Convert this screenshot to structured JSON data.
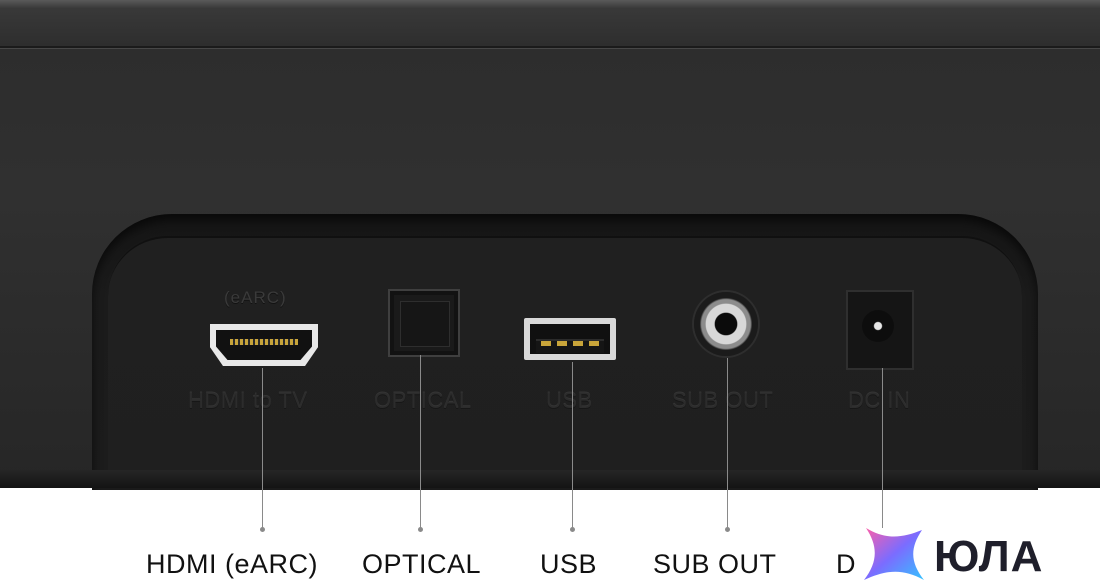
{
  "device": {
    "ports": [
      {
        "id": "hdmi",
        "label": "HDMI to TV",
        "sublabel": "(eARC)"
      },
      {
        "id": "optical",
        "label": "OPTICAL"
      },
      {
        "id": "usb",
        "label": "USB"
      },
      {
        "id": "sub_out",
        "label": "SUB OUT"
      },
      {
        "id": "dc_in",
        "label": "DC IN"
      }
    ]
  },
  "callouts": [
    {
      "label": "HDMI (eARC)"
    },
    {
      "label": "OPTICAL"
    },
    {
      "label": "USB"
    },
    {
      "label": "SUB OUT"
    },
    {
      "label": "D"
    }
  ],
  "watermark": {
    "brand": "ЮЛА",
    "colors": [
      "#ff5ea8",
      "#7b6cff",
      "#34c3ff"
    ]
  }
}
